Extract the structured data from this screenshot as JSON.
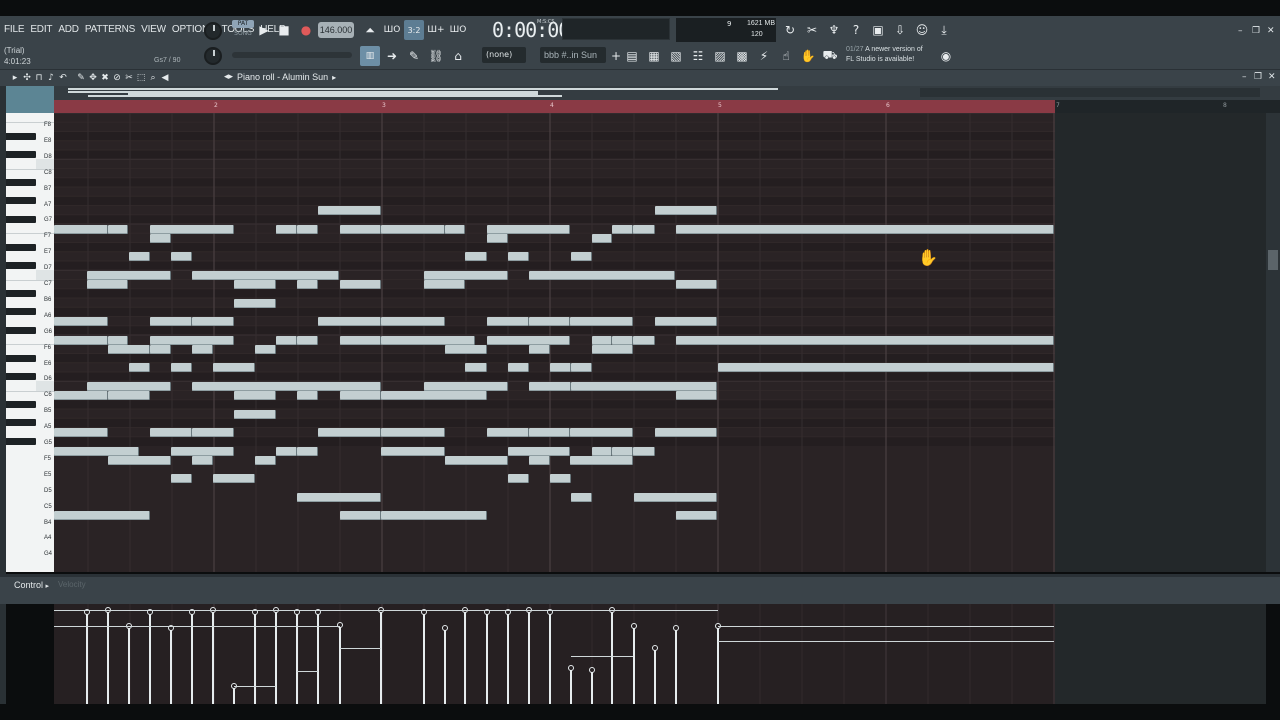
{
  "menu": [
    "FILE",
    "EDIT",
    "ADD",
    "PATTERNS",
    "VIEW",
    "OPTIONS",
    "TOOLS",
    "HELP"
  ],
  "hint": {
    "trial": "(Trial)",
    "time": "4:01:23",
    "note": "Gs7 / 90"
  },
  "pattern_mode": {
    "pat": "PAT",
    "song": "SONG"
  },
  "tempo": "146.000",
  "time_display": "0:00:00",
  "time_unit": "M:S:CS",
  "cpu": {
    "voices": "9",
    "memory": "1621 MB",
    "polyphony": "120"
  },
  "toolbar2": {
    "channel_none": "(none)",
    "pattern": "bbb #..in Sun"
  },
  "news": {
    "date": "01/27",
    "line1": "A newer version of",
    "line2": "FL Studio is available!"
  },
  "piano_roll": {
    "title": "Piano roll - Alumin Sun",
    "title_arrow": "▸"
  },
  "timeline": {
    "bars": [
      "2",
      "3",
      "4",
      "5",
      "6",
      "7",
      "8"
    ]
  },
  "keyboard": {
    "labels": [
      "F8",
      "E8",
      "D8",
      "C8",
      "B7",
      "A7",
      "G7",
      "F7",
      "E7",
      "D7",
      "C7",
      "B6",
      "A6",
      "G6",
      "F6",
      "E6",
      "D6",
      "C6",
      "B5",
      "A5",
      "G5",
      "F5",
      "E5",
      "D5",
      "C5",
      "B4",
      "A4",
      "G4"
    ]
  },
  "event_editor": {
    "label": "Control",
    "arrow": "▸",
    "target": "Velocity"
  },
  "icons": {
    "play": "play-icon",
    "stop": "stop-icon",
    "record": "record-icon",
    "metronome": "metronome-icon",
    "hand_cursor": "hand-cursor-icon"
  },
  "colors": {
    "loop": "#8a3a45",
    "note": "#c3cfd1",
    "grid": "#2a2325",
    "toolbar": "#3a4349"
  }
}
